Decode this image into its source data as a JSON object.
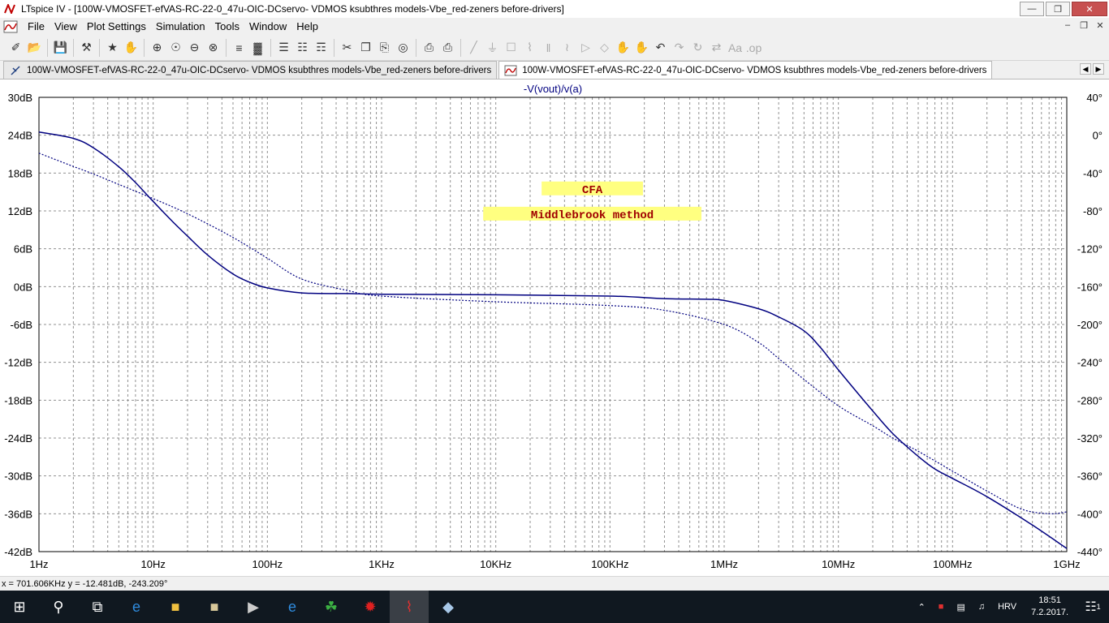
{
  "window": {
    "app_title": "LTspice IV - [100W-VMOSFET-efVAS-RC-22-0_47u-OIC-DCservo- VDMOS ksubthres models-Vbe_red-zeners before-drivers]",
    "controls": [
      "minimize",
      "restore",
      "close"
    ]
  },
  "menu": {
    "items": [
      {
        "label": "File"
      },
      {
        "label": "View"
      },
      {
        "label": "Plot Settings"
      },
      {
        "label": "Simulation"
      },
      {
        "label": "Tools"
      },
      {
        "label": "Window"
      },
      {
        "label": "Help"
      }
    ]
  },
  "toolbar": {
    "buttons": [
      {
        "icon": "new-schematic-icon",
        "glyph": "✐"
      },
      {
        "icon": "open-folder-icon",
        "glyph": "📂"
      },
      {
        "sep": true
      },
      {
        "icon": "save-icon",
        "glyph": "💾"
      },
      {
        "sep": true
      },
      {
        "icon": "control-panel-icon",
        "glyph": "⚒"
      },
      {
        "sep": true
      },
      {
        "icon": "run-icon",
        "glyph": "★"
      },
      {
        "icon": "pan-hand-icon",
        "glyph": "✋"
      },
      {
        "sep": true
      },
      {
        "icon": "zoom-in-icon",
        "glyph": "⊕"
      },
      {
        "icon": "zoom-box-icon",
        "glyph": "☉"
      },
      {
        "icon": "zoom-out-icon",
        "glyph": "⊖"
      },
      {
        "icon": "zoom-fit-icon",
        "glyph": "⊗"
      },
      {
        "sep": true
      },
      {
        "icon": "autorange-icon",
        "glyph": "≡"
      },
      {
        "icon": "grid-icon",
        "glyph": "▓"
      },
      {
        "sep": true
      },
      {
        "icon": "tile-horizontal-icon",
        "glyph": "☰"
      },
      {
        "icon": "cascade-icon",
        "glyph": "☷"
      },
      {
        "icon": "tile-vertical-icon",
        "glyph": "☶"
      },
      {
        "sep": true
      },
      {
        "icon": "cut-icon",
        "glyph": "✂"
      },
      {
        "icon": "copy-icon",
        "glyph": "❐"
      },
      {
        "icon": "paste-icon",
        "glyph": "⎘"
      },
      {
        "icon": "find-icon",
        "glyph": "◎"
      },
      {
        "sep": true
      },
      {
        "icon": "print-icon",
        "glyph": "⎙"
      },
      {
        "icon": "print-setup-icon",
        "glyph": "⎙"
      },
      {
        "sep": true
      },
      {
        "icon": "wire-icon",
        "glyph": "╱",
        "dim": true
      },
      {
        "icon": "ground-icon",
        "glyph": "⏚",
        "dim": true
      },
      {
        "icon": "label-net-icon",
        "glyph": "☐",
        "dim": true
      },
      {
        "icon": "resistor-icon",
        "glyph": "⌇",
        "dim": true
      },
      {
        "icon": "capacitor-icon",
        "glyph": "‖",
        "dim": true
      },
      {
        "icon": "inductor-icon",
        "glyph": "≀",
        "dim": true
      },
      {
        "icon": "diode-icon",
        "glyph": "▷",
        "dim": true
      },
      {
        "icon": "component-icon",
        "glyph": "◇",
        "dim": true
      },
      {
        "icon": "move-hand-icon",
        "glyph": "✋",
        "dim": true
      },
      {
        "icon": "drag-hand-icon",
        "glyph": "✋",
        "dim": true
      },
      {
        "icon": "undo-icon",
        "glyph": "↶"
      },
      {
        "icon": "redo-icon",
        "glyph": "↷",
        "dim": true
      },
      {
        "icon": "rotate-icon",
        "glyph": "↻",
        "dim": true
      },
      {
        "icon": "mirror-icon",
        "glyph": "⇄",
        "dim": true
      },
      {
        "icon": "text-icon",
        "glyph": "Aa",
        "dim": true
      },
      {
        "icon": "spice-directive-icon",
        "glyph": ".op",
        "dim": true
      }
    ]
  },
  "tabs": [
    {
      "label": "100W-VMOSFET-efVAS-RC-22-0_47u-OIC-DCservo- VDMOS ksubthres models-Vbe_red-zeners before-drivers",
      "icon": "schematic-tab-icon",
      "active": false
    },
    {
      "label": "100W-VMOSFET-efVAS-RC-22-0_47u-OIC-DCservo- VDMOS ksubthres models-Vbe_red-zeners before-drivers",
      "icon": "waveform-tab-icon",
      "active": true
    }
  ],
  "chart_data": {
    "type": "line",
    "title": "-V(vout)/v(a)",
    "x_scale": "log",
    "xlim": [
      1,
      1000000000
    ],
    "x_tick_labels": [
      "1Hz",
      "10Hz",
      "100Hz",
      "1KHz",
      "10KHz",
      "100KHz",
      "1MHz",
      "10MHz",
      "100MHz",
      "1GHz"
    ],
    "y_left_lim": [
      -42,
      30
    ],
    "y_left_tick_labels": [
      "30dB",
      "24dB",
      "18dB",
      "12dB",
      "6dB",
      "0dB",
      "-6dB",
      "-12dB",
      "-18dB",
      "-24dB",
      "-30dB",
      "-36dB",
      "-42dB"
    ],
    "y_right_lim": [
      -440,
      40
    ],
    "y_right_tick_labels": [
      "40°",
      "0°",
      "-40°",
      "-80°",
      "-120°",
      "-160°",
      "-200°",
      "-240°",
      "-280°",
      "-320°",
      "-360°",
      "-400°",
      "-440°"
    ],
    "grid": true,
    "series": [
      {
        "name": "magnitude",
        "axis": "left",
        "style": "solid",
        "color": "#000080",
        "x": [
          1,
          2,
          3,
          5,
          7,
          10,
          15,
          20,
          30,
          50,
          70,
          100,
          200,
          500,
          1000,
          10000,
          100000,
          300000,
          700000,
          1000000,
          2000000,
          3000000,
          5000000,
          7000000,
          10000000,
          20000000,
          30000000,
          50000000,
          70000000,
          100000000,
          200000000,
          500000000,
          1000000000
        ],
        "y": [
          24.5,
          23.5,
          22.0,
          19.0,
          16.5,
          13.5,
          10.2,
          8.0,
          5.0,
          2.0,
          0.7,
          -0.2,
          -1.0,
          -1.1,
          -1.2,
          -1.3,
          -1.5,
          -1.9,
          -2.0,
          -2.2,
          -3.5,
          -4.8,
          -7.0,
          -9.7,
          -13.2,
          -19.7,
          -23.3,
          -26.9,
          -28.9,
          -30.4,
          -33.3,
          -37.8,
          -41.5
        ]
      },
      {
        "name": "phase",
        "axis": "right",
        "style": "dotted",
        "color": "#000080",
        "x": [
          1,
          2,
          3,
          5,
          10,
          20,
          50,
          100,
          200,
          500,
          1000,
          10000,
          100000,
          300000,
          1000000,
          2000000,
          3000000,
          5000000,
          10000000,
          20000000,
          30000000,
          50000000,
          100000000,
          200000000,
          400000000,
          700000000,
          1000000000
        ],
        "y": [
          -19,
          -33,
          -41,
          -52,
          -67,
          -83,
          -108,
          -130,
          -152,
          -164,
          -170,
          -176,
          -180,
          -185,
          -200,
          -219,
          -236,
          -258,
          -286,
          -307,
          -320,
          -334,
          -355,
          -376,
          -395,
          -400,
          -398
        ]
      }
    ],
    "annotations": [
      {
        "text": "CFA",
        "x": 70000,
        "y": 15.5,
        "bg": "#ffff80",
        "color": "#a00000"
      },
      {
        "text": "Middlebrook method",
        "x": 70000,
        "y": 11.5,
        "bg": "#ffff80",
        "color": "#a00000"
      }
    ]
  },
  "status": {
    "cursor_readout": "x = 701.606KHz   y = -12.481dB, -243.209°"
  },
  "taskbar": {
    "apps": [
      {
        "icon": "windows-start-icon",
        "glyph": "⊞"
      },
      {
        "icon": "search-icon",
        "glyph": "⚲"
      },
      {
        "icon": "task-view-icon",
        "glyph": "⧉"
      },
      {
        "icon": "edge-browser-icon",
        "glyph": "e",
        "color": "#2f8cdf"
      },
      {
        "icon": "file-explorer-icon",
        "glyph": "■",
        "color": "#f0c040"
      },
      {
        "icon": "folder-app-icon",
        "glyph": "■",
        "color": "#d8c89a"
      },
      {
        "icon": "media-app-icon",
        "glyph": "▶",
        "color": "#cccccc"
      },
      {
        "icon": "internet-explorer-icon",
        "glyph": "e",
        "color": "#2f8cdf"
      },
      {
        "icon": "green-app-icon",
        "glyph": "☘",
        "color": "#3cb043"
      },
      {
        "icon": "red-app-icon",
        "glyph": "✹",
        "color": "#e02020"
      },
      {
        "icon": "ltspice-icon",
        "glyph": "⌇",
        "color": "#e03030",
        "active": true
      },
      {
        "icon": "blue-app-icon",
        "glyph": "◆",
        "color": "#a8c8e8"
      }
    ],
    "tray": {
      "language": "HRV",
      "time": "18:51",
      "date": "7.2.2017.",
      "notification_count": "1"
    }
  }
}
